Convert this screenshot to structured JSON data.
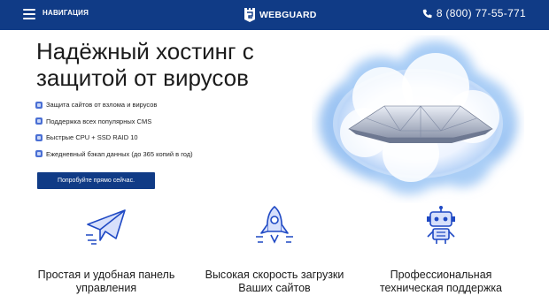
{
  "header": {
    "nav_label": "НАВИГАЦИЯ",
    "logo_text": "WEBGUARD",
    "phone": "8 (800) 77-55-771"
  },
  "hero": {
    "title": "Надёжный хостинг с защитой от вирусов",
    "features": [
      {
        "icon": "shield-gear-icon",
        "text": "Защита сайтов от взлома и вирусов"
      },
      {
        "icon": "cms-settings-icon",
        "text": "Поддержка всех популярных CMS"
      },
      {
        "icon": "server-disk-icon",
        "text": "Быстрые CPU + SSD RAID 10"
      },
      {
        "icon": "home-backup-icon",
        "text": "Ежедневный бэкап данных (до 365 копий в год)"
      }
    ],
    "cta_label": "Попробуйте прямо сейчас."
  },
  "benefits": [
    {
      "icon": "paper-plane-icon",
      "title": "Простая и удобная панель управления"
    },
    {
      "icon": "rocket-icon",
      "title": "Высокая скорость загрузки Ваших сайтов"
    },
    {
      "icon": "robot-icon",
      "title": "Профессиональная техническая поддержка"
    }
  ],
  "colors": {
    "brand": "#103b86",
    "accent": "#1f49c4",
    "text": "#1b1b1b"
  }
}
